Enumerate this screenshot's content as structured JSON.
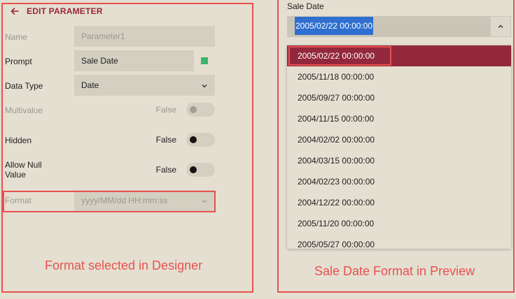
{
  "designer": {
    "title": "EDIT PARAMETER",
    "name": {
      "label": "Name",
      "value": "Parameter1"
    },
    "prompt": {
      "label": "Prompt",
      "value": "Sale Date",
      "indicator_color": "#3fb56b"
    },
    "data_type": {
      "label": "Data Type",
      "value": "Date"
    },
    "multivalue": {
      "label": "Multivalue",
      "value": "False"
    },
    "hidden": {
      "label": "Hidden",
      "value": "False"
    },
    "allow_null": {
      "label": "Allow Null Value",
      "value": "False"
    },
    "format": {
      "label": "Format",
      "value": "yyyy/MM/dd HH:mm:ss"
    },
    "caption": "Format selected in Designer"
  },
  "preview": {
    "label": "Sale Date",
    "selected_value": "2005/02/22 00:00:00",
    "options": [
      "2005/02/22 00:00:00",
      "2005/11/18 00:00:00",
      "2005/09/27 00:00:00",
      "2004/11/15 00:00:00",
      "2004/02/02 00:00:00",
      "2004/03/15 00:00:00",
      "2004/02/23 00:00:00",
      "2004/12/22 00:00:00",
      "2005/11/20 00:00:00",
      "2005/05/27 00:00:00"
    ],
    "caption": "Sale Date Format in Preview"
  },
  "colors": {
    "panel_background": "#e4dfd1",
    "accent": "#93283c",
    "annotation": "#e8524f",
    "selection_highlight": "#2e6fcf"
  },
  "icons": {
    "back": "arrow-left-icon",
    "dropdown": "chevron-down-icon",
    "combo_toggle": "chevron-up-icon"
  }
}
